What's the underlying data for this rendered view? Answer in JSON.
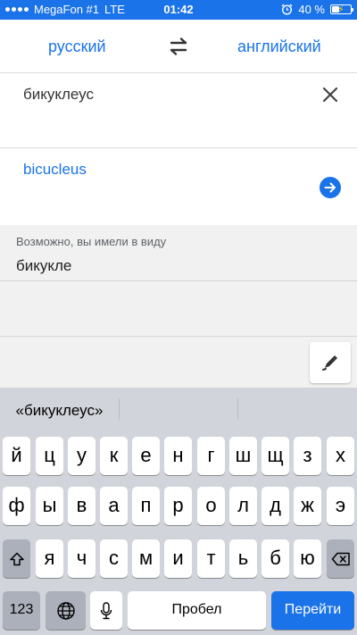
{
  "status_bar": {
    "carrier": "MegaFon #1",
    "network": "LTE",
    "time": "01:42",
    "battery_percent": "40 %",
    "battery_level": 0.4,
    "alarm_icon": "alarm-clock-icon",
    "background": "#1a73e8"
  },
  "language_bar": {
    "source_language": "русский",
    "target_language": "английский",
    "swap_icon": "swap-arrows-icon"
  },
  "input": {
    "text": "бикуклеус",
    "clear_icon": "close-icon"
  },
  "translation": {
    "text": "bicucleus",
    "go_icon": "arrow-right-circle-icon",
    "accent": "#1a73e8"
  },
  "suggestion": {
    "label": "Возможно, вы имели в виду",
    "value": "бикукле"
  },
  "toolbar": {
    "handwriting_icon": "pen-icon"
  },
  "keyboard": {
    "predictions": [
      "«бикуклеус»",
      "",
      ""
    ],
    "row1": [
      "й",
      "ц",
      "у",
      "к",
      "е",
      "н",
      "г",
      "ш",
      "щ",
      "з",
      "х"
    ],
    "row2": [
      "ф",
      "ы",
      "в",
      "а",
      "п",
      "р",
      "о",
      "л",
      "д",
      "ж",
      "э"
    ],
    "row3": [
      "я",
      "ч",
      "с",
      "м",
      "и",
      "т",
      "ь",
      "б",
      "ю"
    ],
    "shift_icon": "shift-icon",
    "backspace_icon": "backspace-icon",
    "numbers_key": "123",
    "globe_icon": "globe-icon",
    "mic_icon": "microphone-icon",
    "space_label": "Пробел",
    "go_label": "Перейти"
  }
}
